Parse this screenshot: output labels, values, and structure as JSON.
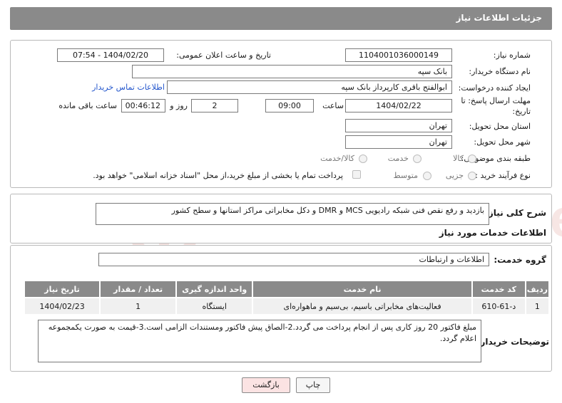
{
  "header": {
    "title": "جزئیات اطلاعات نیاز"
  },
  "form": {
    "need_number_label": "شماره نیاز:",
    "need_number": "1104001036000149",
    "announce_label": "تاریخ و ساعت اعلان عمومی:",
    "announce_value": "1404/02/20 - 07:54",
    "buyer_org_label": "نام دستگاه خریدار:",
    "buyer_org": "بانک سپه",
    "requester_label": "ایجاد کننده درخواست:",
    "requester": "ابوالفتح باقری کارپرداز بانک سپه",
    "contact_link": "اطلاعات تماس خریدار",
    "deadline_label_1": "مهلت ارسال پاسخ: تا",
    "deadline_label_2": "تاریخ:",
    "deadline_date": "1404/02/22",
    "time_label": "ساعت",
    "deadline_time": "09:00",
    "days_value": "2",
    "days_label": "روز و",
    "remaining_time": "00:46:12",
    "remaining_label": "ساعت باقی مانده",
    "province_label": "استان محل تحویل:",
    "province": "تهران",
    "city_label": "شهر محل تحویل:",
    "city": "تهران",
    "category_label": "طبقه بندی موضوعی:",
    "category_options": [
      "کالا",
      "خدمت",
      "کالا/خدمت"
    ],
    "process_label": "نوع فرآیند خرید :",
    "process_options": [
      "جزیی",
      "متوسط"
    ],
    "treasury_note": "پرداخت تمام یا بخشی از مبلغ خرید،از محل \"اسناد خزانه اسلامی\" خواهد بود."
  },
  "summary": {
    "label": "شرح کلی نیاز:",
    "text": "بازدید و رفع نقص فنی  شبکه رادیویی MCS و DMR و دکل مخابراتی مراکز استانها و سطح کشور"
  },
  "services": {
    "section_title": "اطلاعات خدمات مورد نیاز",
    "group_label": "گروه خدمت:",
    "group_value": "اطلاعات و ارتباطات",
    "table": {
      "headers": [
        "ردیف",
        "کد خدمت",
        "نام خدمت",
        "واحد اندازه گیری",
        "تعداد / مقدار",
        "تاریخ نیاز"
      ],
      "rows": [
        [
          "1",
          "د-61-610",
          "فعالیت‌های مخابراتی باسیم، بی‌سیم و ماهواره‌ای",
          "ایستگاه",
          "1",
          "1404/02/23"
        ]
      ]
    }
  },
  "notes": {
    "label": "توضیحات خریدار:",
    "text": "مبلغ فاکتور 20 روز کاری پس از انجام پرداخت می گردد.2-الصاق پیش فاکتور ومستندات الزامی است.3-قیمت به صورت یکمجموعه اعلام گردد."
  },
  "buttons": {
    "print": "چاپ",
    "back": "بازگشت"
  },
  "colors": {
    "header_bg": "#8a8a8a",
    "link": "#2255cc",
    "back_btn_bg": "#fbe3e3",
    "watermark": "#c0392b"
  }
}
